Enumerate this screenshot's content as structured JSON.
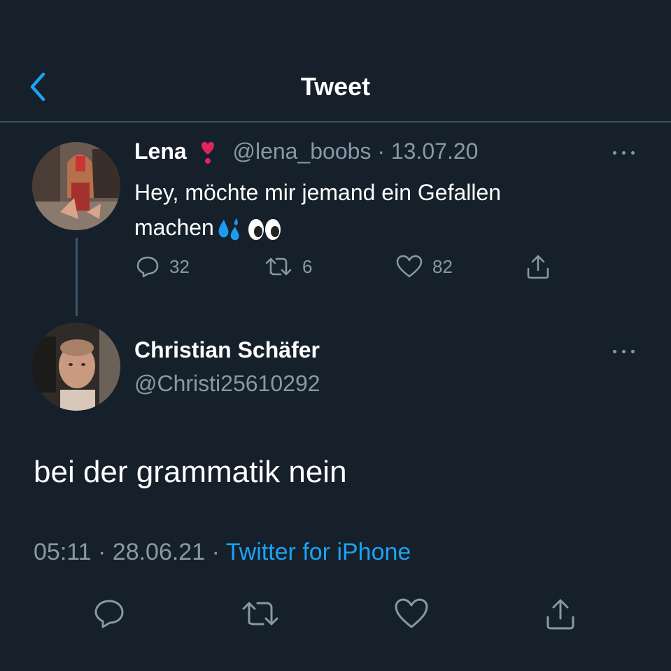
{
  "header": {
    "title": "Tweet",
    "back_icon": "chevron-left-icon"
  },
  "colors": {
    "background": "#15202b",
    "accent": "#1da1f2",
    "muted": "#8899a6",
    "divider": "#3d5466",
    "heart": "#e0245e"
  },
  "parent_tweet": {
    "author_name": "Lena",
    "badge_icon": "heart-exclamation-icon",
    "handle": "@lena_boobs",
    "separator": " · ",
    "date": "13.07.20",
    "text": "Hey, möchte mir jemand ein Gefallen machen",
    "emojis": [
      "sweat-droplets-icon",
      "eyes-icon"
    ],
    "replies": "32",
    "retweets": "6",
    "likes": "82"
  },
  "reply_tweet": {
    "author_name": "Christian Schäfer",
    "handle": "@Christi25610292",
    "text": "bei der grammatik nein",
    "time": "05:11",
    "separator": " · ",
    "date": "28.06.21",
    "source": "Twitter for iPhone"
  }
}
